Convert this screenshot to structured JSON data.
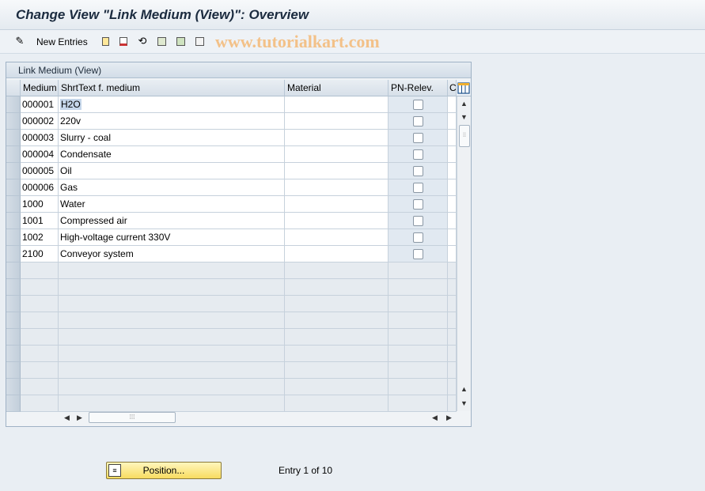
{
  "window": {
    "title": "Change View \"Link Medium (View)\": Overview"
  },
  "toolbar": {
    "new_entries_label": "New Entries",
    "icons": [
      "display-change-icon",
      "copy-as-icon",
      "delete-icon",
      "undo-change-icon",
      "select-all-icon",
      "select-block-icon",
      "deselect-all-icon"
    ]
  },
  "watermark": "www.tutorialkart.com",
  "table": {
    "title": "Link Medium (View)",
    "columns": [
      "Medium",
      "ShrtText f. medium",
      "Material",
      "PN-Relev.",
      "C"
    ],
    "rows": [
      {
        "medium": "000001",
        "text": "H2O",
        "material": "",
        "pn_relev": false
      },
      {
        "medium": "000002",
        "text": "220v",
        "material": "",
        "pn_relev": false
      },
      {
        "medium": "000003",
        "text": "Slurry - coal",
        "material": "",
        "pn_relev": false
      },
      {
        "medium": "000004",
        "text": "Condensate",
        "material": "",
        "pn_relev": false
      },
      {
        "medium": "000005",
        "text": "Oil",
        "material": "",
        "pn_relev": false
      },
      {
        "medium": "000006",
        "text": "Gas",
        "material": "",
        "pn_relev": false
      },
      {
        "medium": "1000",
        "text": "Water",
        "material": "",
        "pn_relev": false
      },
      {
        "medium": "1001",
        "text": "Compressed air",
        "material": "",
        "pn_relev": false
      },
      {
        "medium": "1002",
        "text": "High-voltage current 330V",
        "material": "",
        "pn_relev": false
      },
      {
        "medium": "2100",
        "text": "Conveyor system",
        "material": "",
        "pn_relev": false
      }
    ],
    "empty_row_count": 9
  },
  "footer": {
    "position_button_label": "Position...",
    "entry_text": "Entry 1 of 10"
  },
  "colors": {
    "position_button": "#f8dc60",
    "grid_checkbox_column": "#e1e9f1"
  }
}
